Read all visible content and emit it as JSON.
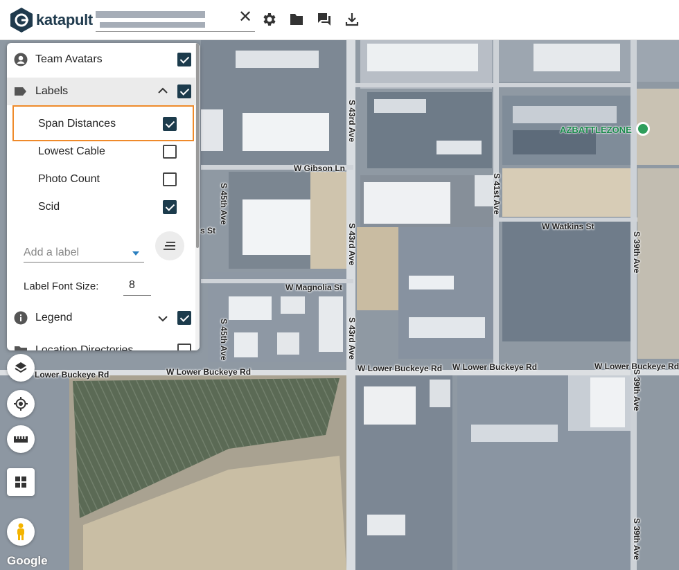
{
  "app": {
    "name": "katapult"
  },
  "topbar": {
    "icons": [
      "clear-icon",
      "gear-icon",
      "folder-icon",
      "chat-icon",
      "download-icon"
    ],
    "clear_glyph": "✕"
  },
  "layers_panel": {
    "items": [
      {
        "label": "Team Avatars",
        "checked": true,
        "icon": "avatar-icon"
      },
      {
        "label": "Labels",
        "checked": true,
        "icon": "label-tag-icon",
        "expanded": true
      },
      {
        "label": "Span Distances",
        "checked": true
      },
      {
        "label": "Lowest Cable",
        "checked": false
      },
      {
        "label": "Photo Count",
        "checked": false
      },
      {
        "label": "Scid",
        "checked": true
      },
      {
        "label": "Legend",
        "checked": true,
        "icon": "info-icon"
      },
      {
        "label": "Location Directories",
        "checked": false
      }
    ],
    "add_label_placeholder": "Add a label",
    "font_size_label": "Label Font Size:",
    "font_size_value": "8"
  },
  "map": {
    "roads": {
      "gibson": "W Gibson Ln",
      "magnolia": "W Magnolia St",
      "watkins": "W Watkins St",
      "lower_buckeye_1": "Lower Buckeye Rd",
      "lower_buckeye_2": "W Lower Buckeye Rd",
      "lower_buckeye_3": "W Lower Buckeye Rd",
      "lower_buckeye_4": "W Lower Buckeye Rd",
      "lower_buckeye_5": "W Lower Buckeye Rd",
      "ave_43rd_a": "S 43rd Ave",
      "ave_43rd_b": "S 43rd Ave",
      "ave_43rd_c": "S 43rd Ave",
      "ave_45th_a": "S 45th Ave",
      "ave_45th_b": "S 45th Ave",
      "ave_41st": "S 41st Ave",
      "ave_39th_a": "S 39th Ave",
      "ave_39th_b": "S 39th Ave",
      "ave_39th_c": "S 39th Ave",
      "partial_st": "s St"
    },
    "poi": "AZBATTLEZONE",
    "attribution": "Google"
  },
  "map_controls": [
    "layers-icon",
    "locate-icon",
    "ruler-icon",
    "grid-icon",
    "pegman-icon"
  ]
}
